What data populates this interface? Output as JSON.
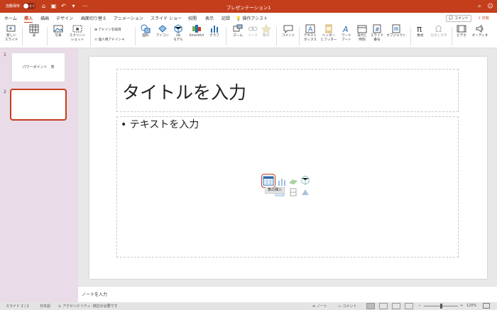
{
  "titlebar": {
    "autosave": "自動保存",
    "toggle": "オフ",
    "title": "プレゼンテーション1"
  },
  "tabs": [
    "ホーム",
    "挿入",
    "描画",
    "デザイン",
    "画面切り替え",
    "アニメーション",
    "スライド ショー",
    "校閲",
    "表示",
    "記録",
    "操作アシスト"
  ],
  "active_tab": "挿入",
  "comment": "コメント",
  "share": "共有",
  "ribbon": {
    "new_slide": "新しい\nスライド",
    "table": "表",
    "photo": "写真",
    "screenshot": "スクリーン\nショット",
    "addin_get": "アドインを取得",
    "addin_mine": "個人用アドイン",
    "shapes": "図形",
    "icons": "アイコン",
    "model3d": "3D\nモデル",
    "smartart": "SmartArt",
    "chart": "グラフ",
    "zoom": "ズーム",
    "link": "リンク",
    "action": "動作",
    "comment": "コメント",
    "textbox": "テキスト\nボックス",
    "header": "ヘッダー\nとフッター",
    "wordart": "ワード\nアート",
    "datetime": "日付と\n時刻",
    "slidenum": "スライド\n番号",
    "object": "オブジェクト",
    "equation": "数式",
    "symbol": "記号と文字",
    "video": "ビデオ",
    "audio": "オーディオ"
  },
  "slides": [
    {
      "num": "1",
      "text": "パワーポイント　表"
    },
    {
      "num": "2",
      "text": ""
    }
  ],
  "slide": {
    "title_placeholder": "タイトルを入力",
    "body_placeholder": "• テキストを入力",
    "tooltip": "表の挿入"
  },
  "notes": "ノートを入力",
  "status": {
    "slide": "スライド 2 / 2",
    "lang": "日本語",
    "access": "アクセシビリティ: 検討が必要です",
    "notes": "ノート",
    "comments": "コメント",
    "zoom": "120%"
  },
  "colors": {
    "accent": "#c43e1c"
  }
}
